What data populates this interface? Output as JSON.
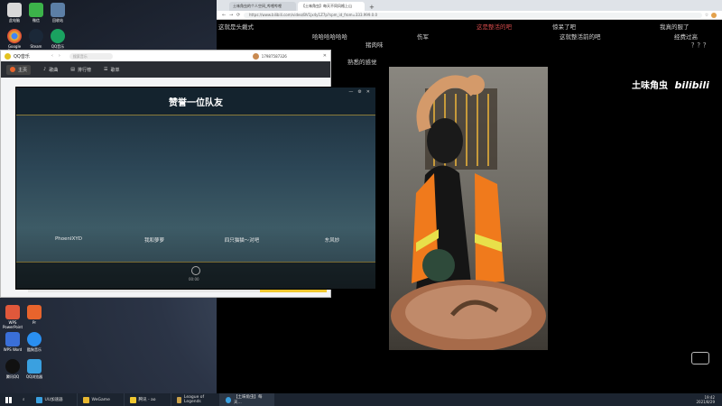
{
  "desktop": {
    "icons": [
      {
        "label": "此电脑",
        "color": "#d8d8d8"
      },
      {
        "label": "微信",
        "color": "#3cb34a"
      },
      {
        "label": "回收站",
        "color": "#5c7fa6"
      },
      {
        "label": "Google Chrome",
        "color": "#e9b930"
      },
      {
        "label": "Steam",
        "color": "#1b2838"
      },
      {
        "label": "QQ音乐",
        "color": "#1aa260"
      },
      {
        "label": "WPS PowerPoint",
        "color": "#e0583b"
      },
      {
        "label": "Pr",
        "color": "#e8642c"
      },
      {
        "label": "WPS Word",
        "color": "#3a6fd8"
      },
      {
        "label": "酷狗音乐",
        "color": "#2a8ff0"
      },
      {
        "label": "腾讯QQ",
        "color": "#111111"
      },
      {
        "label": "QQ浏览器",
        "color": "#3aa0e0"
      }
    ]
  },
  "browser": {
    "tabs": [
      {
        "label": "土味角虫的个人空间_哔哩哔哩"
      },
      {
        "label": "【土味角虫】每天不同风格上山"
      }
    ],
    "url": "https://www.bilibili.com/video/BV1jx4y1Z7p?spm_id_from=333.999.0.0",
    "danmaku": [
      "哈哈哈哈哈哈",
      "伤军",
      "惊呆了吧",
      "这就整活前的吧",
      "这是整活的吧",
      "我真的服了",
      "？？？",
      "经费过高",
      "这就是头戴式",
      "猪肉味",
      "熟悉的感觉"
    ],
    "brand": "土味角虫",
    "logo": "bilibili"
  },
  "qqmusic": {
    "app_name": "QQ音乐",
    "search_placeholder": "搜索音乐",
    "nav": [
      "主页",
      "歌曲",
      "排行榜",
      "歌单"
    ],
    "user": "17987587326"
  },
  "praise_dialog": {
    "title": "赞誉一位队友",
    "teammates": [
      "PhoenIXYD",
      "我和萝萝",
      "四只猫猫～对吧",
      "东风妙"
    ],
    "timer": "00:00"
  },
  "taskbar": {
    "items": [
      "UU加速器",
      "WeGame",
      "腾讯 - ao",
      "League of Legends",
      "【土味角虫】每天..."
    ],
    "time": "19:42",
    "date": "2021/8/29"
  }
}
